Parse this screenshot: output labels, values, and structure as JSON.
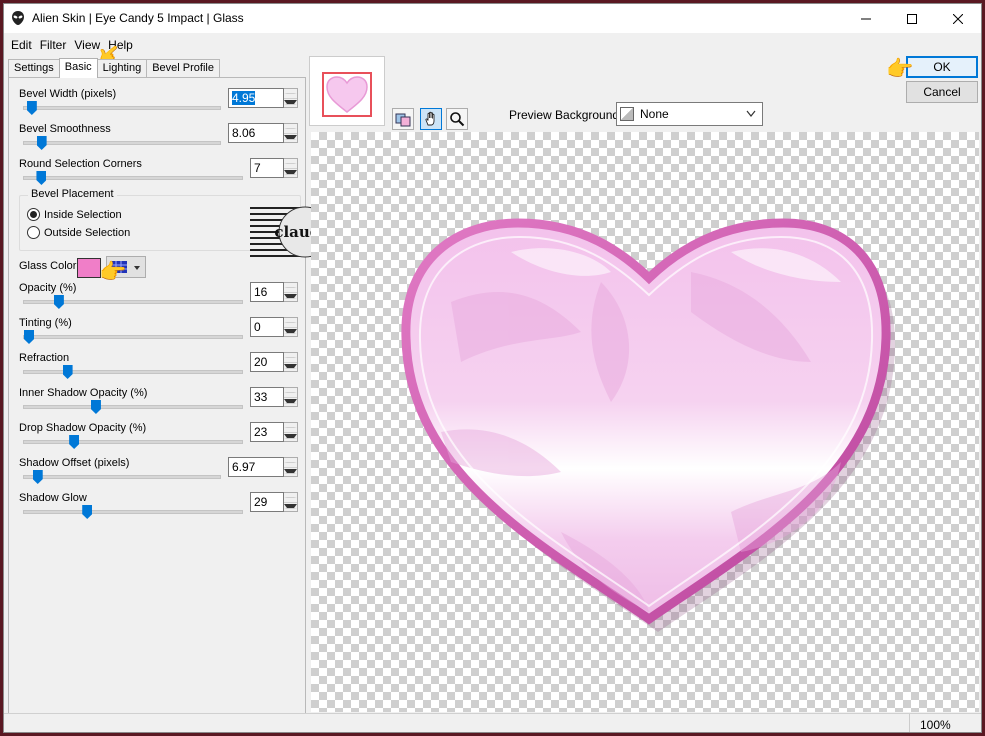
{
  "window": {
    "title": "Alien Skin | Eye Candy 5 Impact | Glass"
  },
  "menu": [
    "Edit",
    "Filter",
    "View",
    "Help"
  ],
  "tabs": [
    {
      "label": "Settings",
      "active": false
    },
    {
      "label": "Basic",
      "active": true
    },
    {
      "label": "Lighting",
      "active": false
    },
    {
      "label": "Bevel Profile",
      "active": false
    }
  ],
  "controls": {
    "bevel_width": {
      "label": "Bevel Width (pixels)",
      "value": "4.95",
      "slider": 0.04
    },
    "bevel_smoothness": {
      "label": "Bevel Smoothness",
      "value": "8.06",
      "slider": 0.09
    },
    "round_corners": {
      "label": "Round Selection Corners",
      "value": "7",
      "slider": 0.08
    },
    "opacity": {
      "label": "Opacity (%)",
      "value": "16",
      "slider": 0.16
    },
    "tinting": {
      "label": "Tinting (%)",
      "value": "0",
      "slider": 0.0
    },
    "refraction": {
      "label": "Refraction",
      "value": "20",
      "slider": 0.2
    },
    "inner_shadow": {
      "label": "Inner Shadow Opacity (%)",
      "value": "33",
      "slider": 0.33
    },
    "drop_shadow": {
      "label": "Drop Shadow Opacity (%)",
      "value": "23",
      "slider": 0.23
    },
    "shadow_offset": {
      "label": "Shadow Offset (pixels)",
      "value": "6.97",
      "slider": 0.07
    },
    "shadow_glow": {
      "label": "Shadow Glow",
      "value": "29",
      "slider": 0.29
    }
  },
  "bevel_placement": {
    "title": "Bevel Placement",
    "inside": "Inside Selection",
    "outside": "Outside Selection",
    "selected": "inside"
  },
  "glass_color": {
    "label": "Glass Color",
    "color": "#f07ec8"
  },
  "preview": {
    "background_label": "Preview Background:",
    "background_value": "None",
    "zoom": "100%"
  },
  "buttons": {
    "ok": "OK",
    "cancel": "Cancel"
  },
  "watermark_text": "claudia",
  "colors": {
    "accent": "#0078d7",
    "heart_rim": "#d264b4",
    "heart_fill": "#f5c8ec"
  }
}
